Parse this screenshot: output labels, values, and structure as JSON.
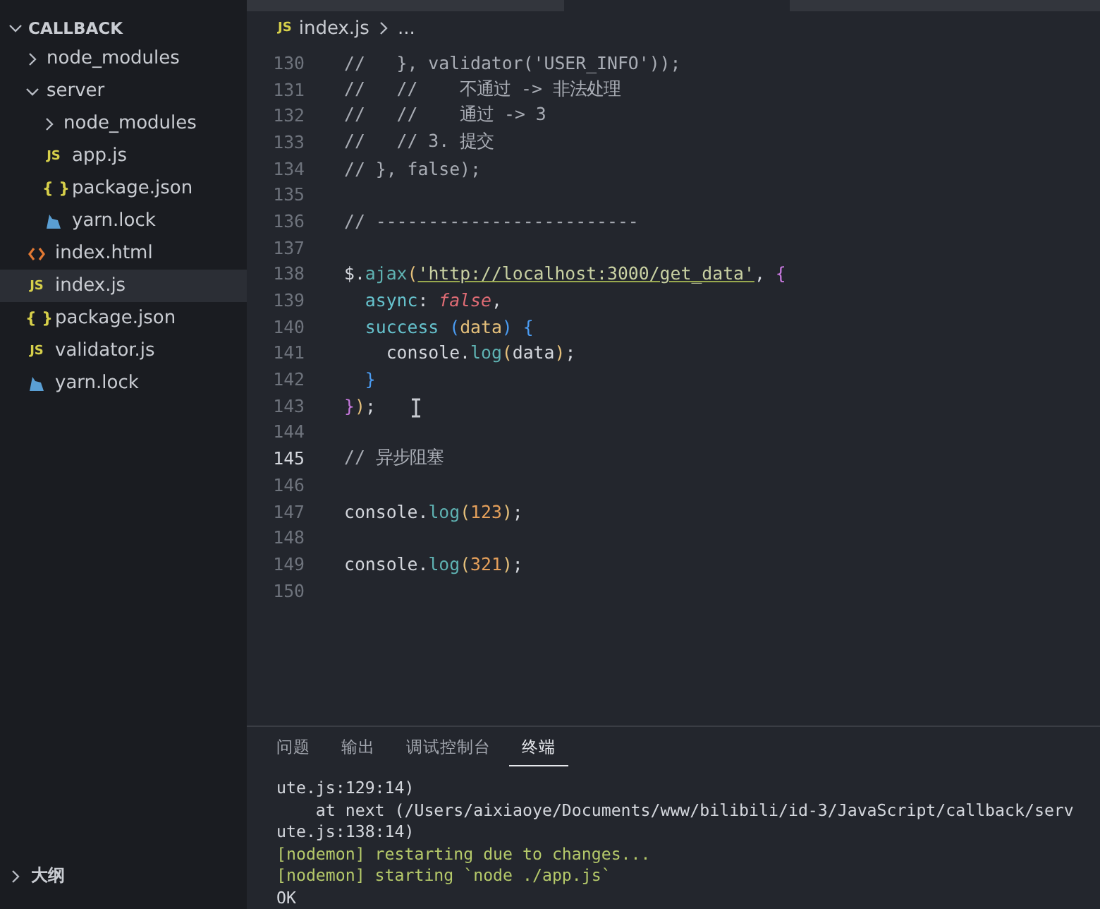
{
  "explorer": {
    "title": "CALLBACK",
    "expanded": true,
    "items": [
      {
        "label": "node_modules",
        "kind": "folder",
        "expanded": false,
        "selected": false
      },
      {
        "label": "server",
        "kind": "folder",
        "expanded": true,
        "selected": false,
        "children": [
          {
            "label": "node_modules",
            "kind": "folder",
            "expanded": false,
            "selected": false
          },
          {
            "label": "app.js",
            "kind": "js",
            "icon": "JS",
            "selected": false
          },
          {
            "label": "package.json",
            "kind": "json",
            "icon": "{ }",
            "selected": false
          },
          {
            "label": "yarn.lock",
            "kind": "yarn",
            "selected": false
          }
        ]
      },
      {
        "label": "index.html",
        "kind": "html",
        "selected": false
      },
      {
        "label": "index.js",
        "kind": "js",
        "icon": "JS",
        "selected": true
      },
      {
        "label": "package.json",
        "kind": "json",
        "icon": "{ }",
        "selected": false
      },
      {
        "label": "validator.js",
        "kind": "js",
        "icon": "JS",
        "selected": false
      },
      {
        "label": "yarn.lock",
        "kind": "yarn",
        "selected": false
      }
    ],
    "sections": [
      {
        "label": "大纲",
        "expanded": false
      }
    ]
  },
  "breadcrumb": {
    "icon": "JS",
    "file": "index.js",
    "rest": "..."
  },
  "editor": {
    "lines": [
      {
        "number": "130",
        "current": false,
        "tokens": [
          {
            "text": "//   }, validator('USER_INFO'));",
            "kind": "comment"
          }
        ]
      },
      {
        "number": "131",
        "current": false,
        "tokens": [
          {
            "text": "//   //    不通过 -> 非法处理",
            "kind": "comment"
          }
        ]
      },
      {
        "number": "132",
        "current": false,
        "tokens": [
          {
            "text": "//   //    通过 -> 3",
            "kind": "comment"
          }
        ]
      },
      {
        "number": "133",
        "current": false,
        "tokens": [
          {
            "text": "//   // 3. 提交",
            "kind": "comment"
          }
        ]
      },
      {
        "number": "134",
        "current": false,
        "tokens": [
          {
            "text": "// }, false);",
            "kind": "comment"
          }
        ]
      },
      {
        "number": "135",
        "current": false
      },
      {
        "number": "136",
        "current": false,
        "tokens": [
          {
            "text": "// -------------------------",
            "kind": "comment"
          }
        ]
      },
      {
        "number": "137",
        "current": false
      },
      {
        "number": "138",
        "current": false,
        "tokens": [
          {
            "text": "$.",
            "kind": "plain"
          },
          {
            "text": "ajax",
            "kind": "func"
          },
          {
            "text": "(",
            "kind": "paren1"
          },
          {
            "text": "'http://localhost:3000/get_data'",
            "kind": "string"
          },
          {
            "text": ", ",
            "kind": "plain"
          },
          {
            "text": "{",
            "kind": "paren2"
          }
        ]
      },
      {
        "number": "139",
        "current": false,
        "tokens": [
          {
            "text": "  async",
            "kind": "prop"
          },
          {
            "text": ": ",
            "kind": "plain"
          },
          {
            "text": "false",
            "kind": "bool"
          },
          {
            "text": ",",
            "kind": "plain"
          }
        ]
      },
      {
        "number": "140",
        "current": false,
        "tokens": [
          {
            "text": "  success",
            "kind": "prop"
          },
          {
            "text": " (",
            "kind": "paren3"
          },
          {
            "text": "data",
            "kind": "param"
          },
          {
            "text": ") {",
            "kind": "paren3"
          }
        ]
      },
      {
        "number": "141",
        "current": false,
        "tokens": [
          {
            "text": "    console.",
            "kind": "plain"
          },
          {
            "text": "log",
            "kind": "func"
          },
          {
            "text": "(",
            "kind": "paren1"
          },
          {
            "text": "data",
            "kind": "plain"
          },
          {
            "text": ")",
            "kind": "paren1"
          },
          {
            "text": ";",
            "kind": "plain"
          }
        ]
      },
      {
        "number": "142",
        "current": false,
        "tokens": [
          {
            "text": "  }",
            "kind": "paren3"
          }
        ]
      },
      {
        "number": "143",
        "current": false,
        "tokens": [
          {
            "text": "}",
            "kind": "paren2"
          },
          {
            "text": ")",
            "kind": "paren1"
          },
          {
            "text": ";",
            "kind": "plain"
          }
        ]
      },
      {
        "number": "144",
        "current": false
      },
      {
        "number": "145",
        "current": true,
        "tokens": [
          {
            "text": "// 异步阻塞",
            "kind": "comment"
          }
        ]
      },
      {
        "number": "146",
        "current": false
      },
      {
        "number": "147",
        "current": false,
        "tokens": [
          {
            "text": "console.",
            "kind": "plain"
          },
          {
            "text": "log",
            "kind": "func"
          },
          {
            "text": "(",
            "kind": "paren1"
          },
          {
            "text": "123",
            "kind": "number"
          },
          {
            "text": ")",
            "kind": "paren1"
          },
          {
            "text": ";",
            "kind": "plain"
          }
        ]
      },
      {
        "number": "148",
        "current": false
      },
      {
        "number": "149",
        "current": false,
        "tokens": [
          {
            "text": "console.",
            "kind": "plain"
          },
          {
            "text": "log",
            "kind": "func"
          },
          {
            "text": "(",
            "kind": "paren1"
          },
          {
            "text": "321",
            "kind": "number"
          },
          {
            "text": ")",
            "kind": "paren1"
          },
          {
            "text": ";",
            "kind": "plain"
          }
        ]
      },
      {
        "number": "150",
        "current": false
      }
    ]
  },
  "panel": {
    "tabs": [
      {
        "label": "问题",
        "selected": false
      },
      {
        "label": "输出",
        "selected": false
      },
      {
        "label": "调试控制台",
        "selected": false
      },
      {
        "label": "终端",
        "selected": true
      }
    ],
    "terminal": [
      {
        "text": "ute.js:129:14)",
        "kind": "plain"
      },
      {
        "text": "    at next (/Users/aixiaoye/Documents/www/bilibili/id-3/JavaScript/callback/serv",
        "kind": "plain"
      },
      {
        "text": "ute.js:138:14)",
        "kind": "plain"
      },
      {
        "text": "[nodemon] restarting due to changes...",
        "kind": "nodemon"
      },
      {
        "text": "[nodemon] starting `node ./app.js`",
        "kind": "nodemon"
      },
      {
        "text": "OK",
        "kind": "plain"
      }
    ]
  }
}
